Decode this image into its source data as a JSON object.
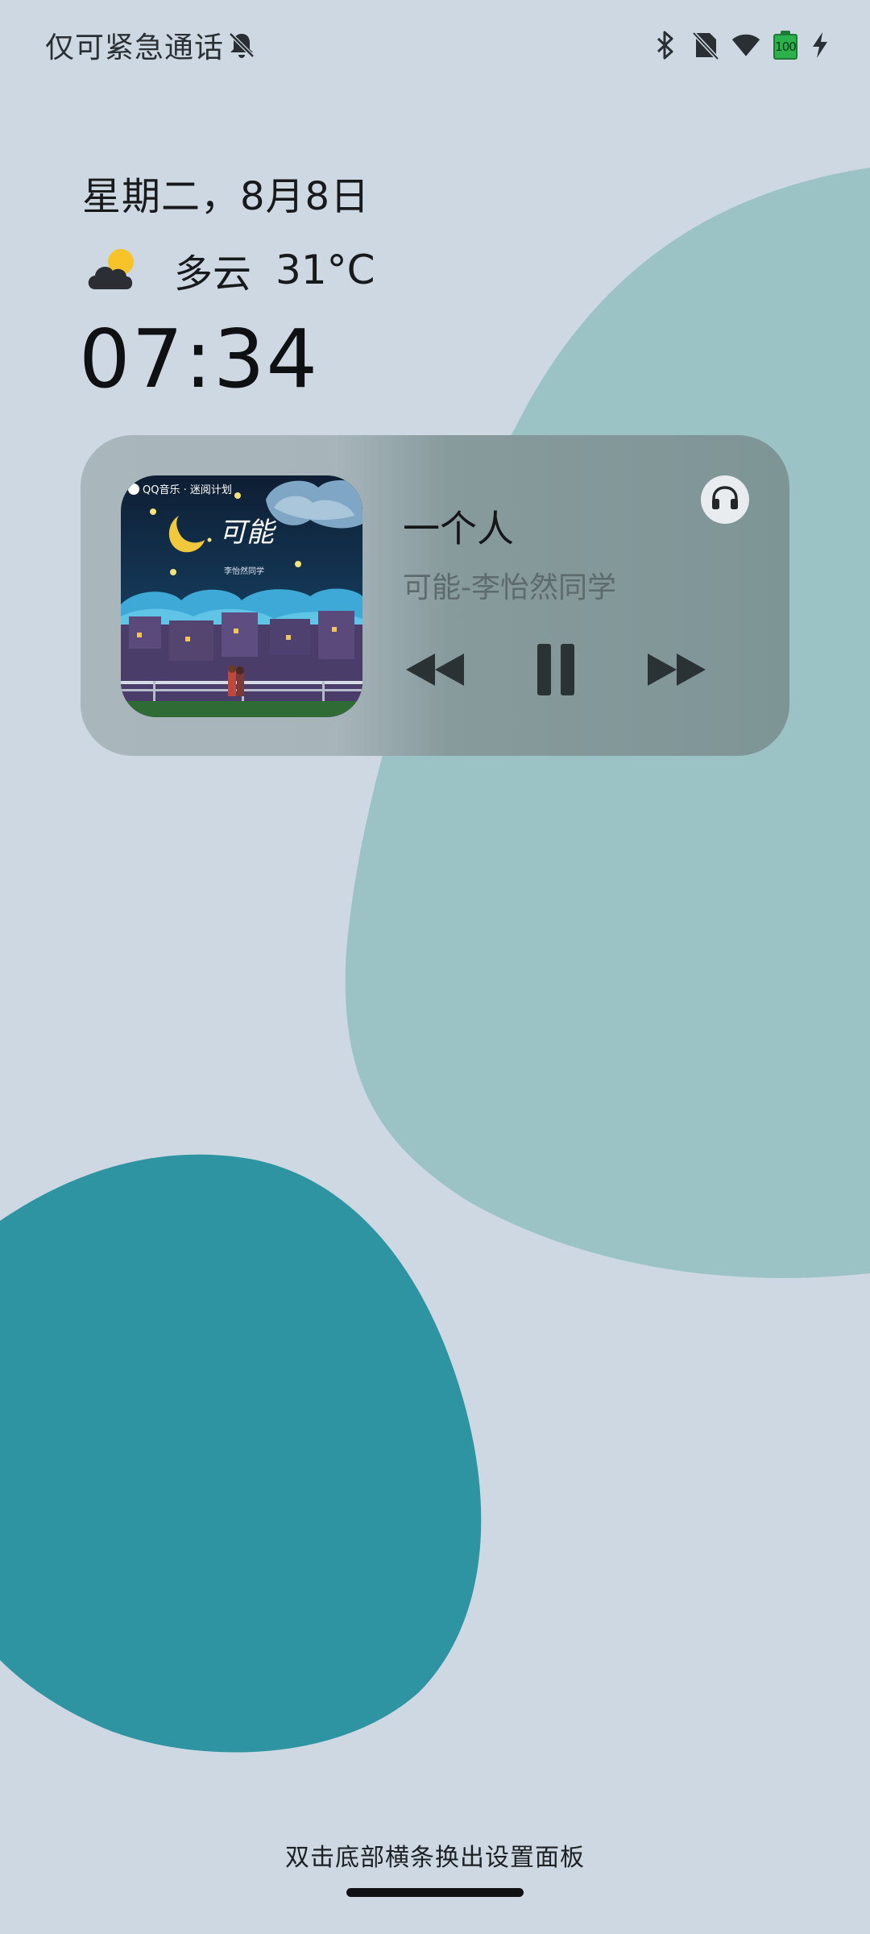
{
  "status_bar": {
    "carrier_text": "仅可紧急通话",
    "battery_level": "100",
    "icons": [
      "mute-bell-icon",
      "bluetooth-icon",
      "no-sim-icon",
      "wifi-icon",
      "battery-icon",
      "charging-bolt-icon"
    ]
  },
  "lockscreen": {
    "date": "星期二，8月8日",
    "weather": {
      "icon": "partly-cloudy-icon",
      "condition": "多云",
      "temperature": "31°C"
    },
    "time": "07:34"
  },
  "music": {
    "title": "一个人",
    "subtitle": "可能-李怡然同学",
    "album_art": {
      "badge_text": "QQ音乐 · 迷阅计划",
      "calligraphy": "可能",
      "artist_caption": "李怡然同学"
    },
    "controls": [
      "rewind-icon",
      "pause-icon",
      "fast-forward-icon"
    ],
    "output_icon": "headphones-icon"
  },
  "bottom_hint": "双击底部横条换出设置面板",
  "colors": {
    "background": "#cdd8e2",
    "blob_light": "#9bc3c5",
    "blob_dark": "#2e94a2",
    "card_left": "#a9b7bd",
    "card_right": "#7e9596"
  }
}
